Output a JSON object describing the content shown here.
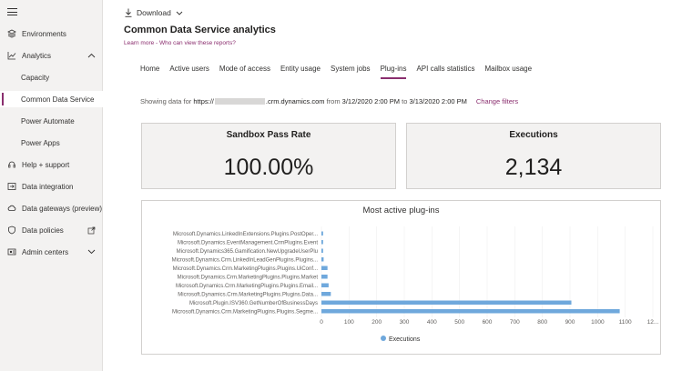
{
  "sidebar": {
    "items": [
      {
        "label": "Environments",
        "icon": "layers-icon"
      },
      {
        "label": "Analytics",
        "icon": "chart-line-icon",
        "expanded": true
      },
      {
        "label": "Capacity"
      },
      {
        "label": "Common Data Service",
        "active": true
      },
      {
        "label": "Power Automate"
      },
      {
        "label": "Power Apps"
      },
      {
        "label": "Help + support",
        "icon": "headset-icon"
      },
      {
        "label": "Data integration",
        "icon": "data-integration-icon"
      },
      {
        "label": "Data gateways (preview)",
        "icon": "cloud-upload-icon"
      },
      {
        "label": "Data policies",
        "icon": "shield-icon"
      },
      {
        "label": "Admin centers",
        "icon": "admin-icon"
      }
    ]
  },
  "toolbar": {
    "download_label": "Download"
  },
  "page": {
    "title": "Common Data Service analytics",
    "learn_more": "Learn more - Who can view these reports?"
  },
  "tabs": [
    "Home",
    "Active users",
    "Mode of access",
    "Entity usage",
    "System jobs",
    "Plug-ins",
    "API calls statistics",
    "Mailbox usage"
  ],
  "active_tab": "Plug-ins",
  "info": {
    "prefix": "Showing data for ",
    "url_start": "https://",
    "url_end": ".crm.dynamics.com",
    "from_label": " from ",
    "from": "3/12/2020 2:00 PM",
    "to_label": " to ",
    "to": "3/13/2020 2:00 PM",
    "change_filters": "Change filters"
  },
  "kpis": {
    "pass_rate": {
      "title": "Sandbox Pass Rate",
      "value": "100.00%"
    },
    "executions": {
      "title": "Executions",
      "value": "2,134"
    }
  },
  "colors": {
    "accent": "#8a2e6e",
    "bar": "#6fa8dc"
  },
  "chart_data": {
    "type": "bar",
    "orientation": "horizontal",
    "title": "Most active plug-ins",
    "categories": [
      "Microsoft.Dynamics.LinkedInExtensions.Plugins.PostOper...",
      "Microsoft.Dynamics.EventManagement.CrmPlugins.Event",
      "Microsoft.Dynamics365.Gamification.NewUpgradeUserPlu",
      "Microsoft.Dynamics.Crm.LinkedInLeadGenPlugins.Plugins...",
      "Microsoft.Dynamics.Crm.MarketingPlugins.Plugins.UiConf...",
      "Microsoft.Dynamics.Crm.MarketingPlugins.Plugins.Market",
      "Microsoft.Dynamics.Crm.MarketingPlugins.Plugins.Email...",
      "Microsoft.Dynamics.Crm.MarketingPlugins.Plugins.Data...",
      "Microsoft.Plugin.ISV360.GetNumberOfBusinessDays",
      "Microsoft.Dynamics.Crm.MarketingPlugins.Plugins.Segme..."
    ],
    "series": [
      {
        "name": "Executions",
        "values": [
          6,
          6,
          6,
          8,
          22,
          22,
          26,
          34,
          905,
          1080
        ]
      }
    ],
    "x_ticks": [
      "0",
      "100",
      "200",
      "300",
      "400",
      "500",
      "600",
      "700",
      "800",
      "900",
      "1000",
      "1100",
      "12..."
    ],
    "xlim": [
      0,
      1200
    ],
    "legend": "bottom"
  }
}
